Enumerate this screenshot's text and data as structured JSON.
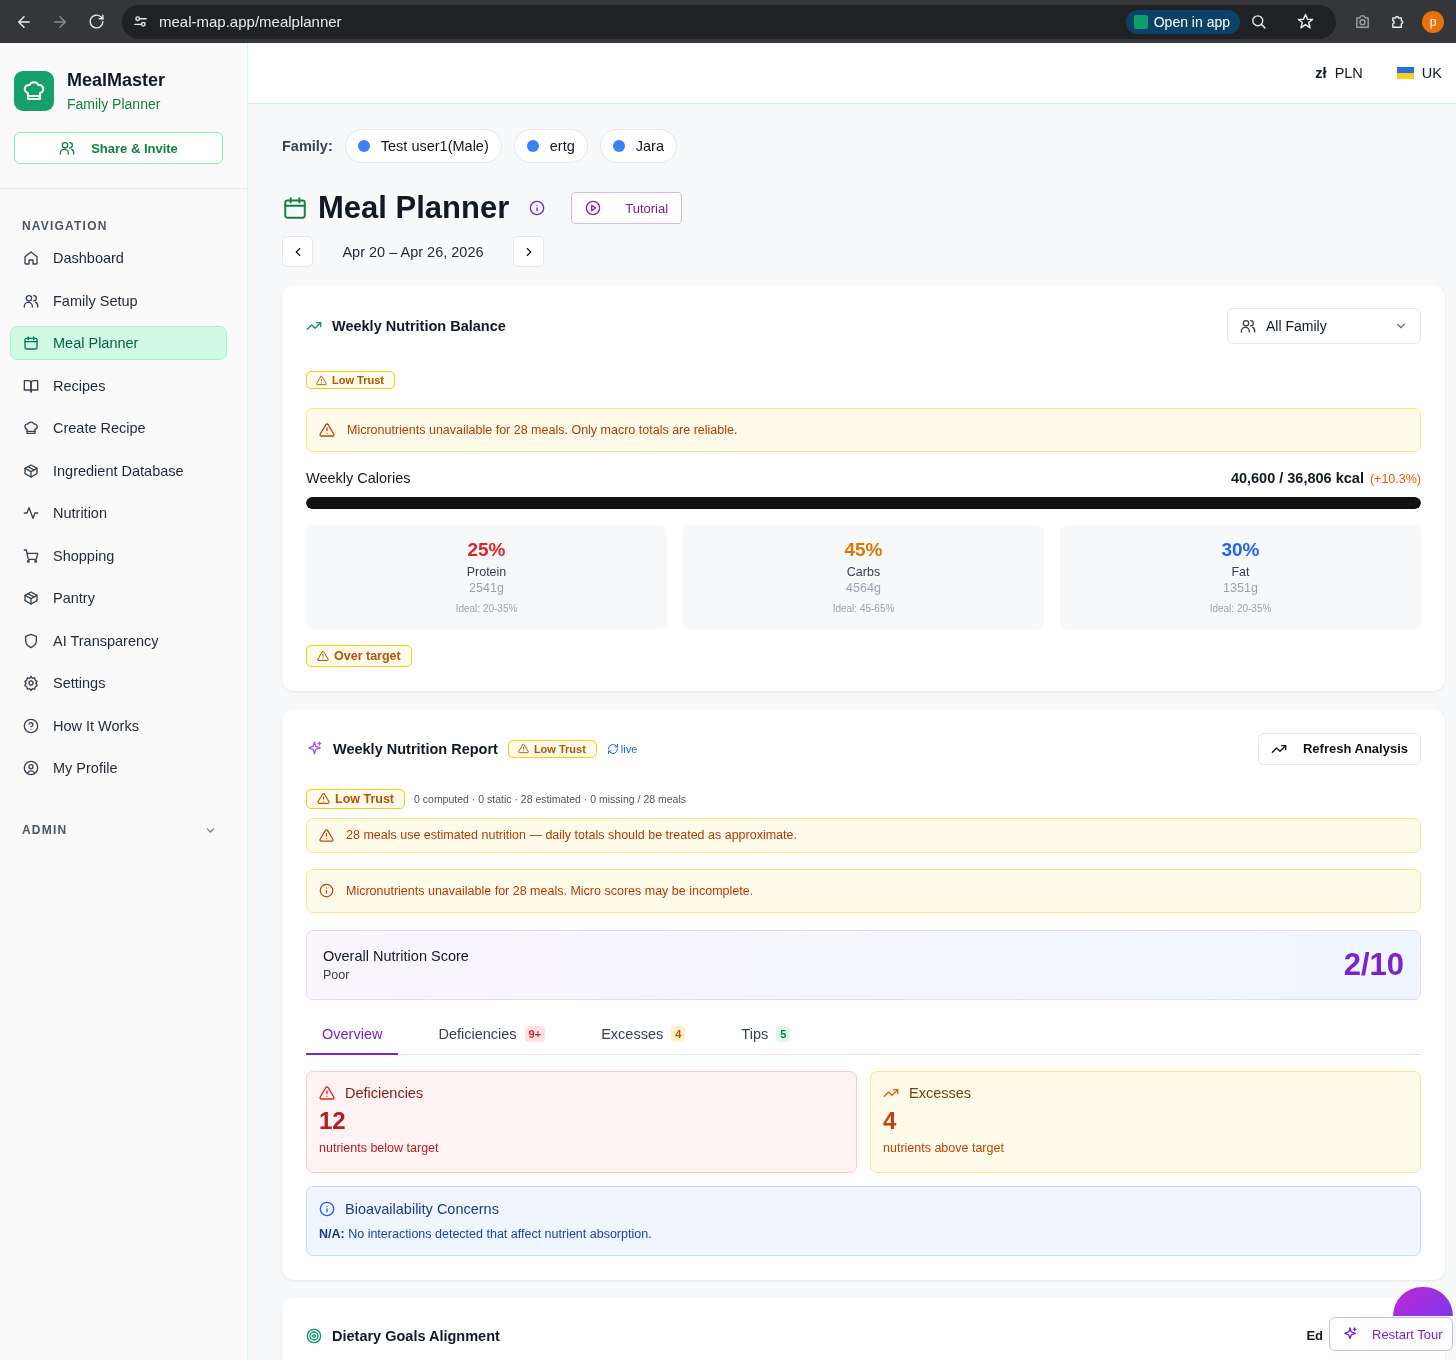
{
  "browser": {
    "url": "meal-map.app/mealplanner",
    "open_in_app": "Open in app",
    "profile_initial": "p"
  },
  "sidebar": {
    "app_name": "MealMaster",
    "subtitle": "Family Planner",
    "share_button": "Share & Invite",
    "nav_heading": "NAVIGATION",
    "items": [
      {
        "label": "Dashboard",
        "selected": false
      },
      {
        "label": "Family Setup",
        "selected": false
      },
      {
        "label": "Meal Planner",
        "selected": true
      },
      {
        "label": "Recipes",
        "selected": false
      },
      {
        "label": "Create Recipe",
        "selected": false
      },
      {
        "label": "Ingredient Database",
        "selected": false
      },
      {
        "label": "Nutrition",
        "selected": false
      },
      {
        "label": "Shopping",
        "selected": false
      },
      {
        "label": "Pantry",
        "selected": false
      },
      {
        "label": "AI Transparency",
        "selected": false
      },
      {
        "label": "Settings",
        "selected": false
      },
      {
        "label": "How It Works",
        "selected": false
      },
      {
        "label": "My Profile",
        "selected": false
      }
    ],
    "admin_heading": "ADMIN",
    "admin_expanded": false
  },
  "topbar": {
    "currency_symbol": "zł",
    "currency": "PLN",
    "language": "UK"
  },
  "family": {
    "label": "Family:",
    "members": [
      {
        "name": "Test user1(Male)",
        "color": "#3b82f6"
      },
      {
        "name": "ertg",
        "color": "#3b82f6"
      },
      {
        "name": "Jara",
        "color": "#3b82f6"
      }
    ]
  },
  "header": {
    "title": "Meal Planner",
    "tutorial": "Tutorial",
    "date_range": "Apr 20 – Apr 26, 2026"
  },
  "balance": {
    "title": "Weekly Nutrition Balance",
    "filter": "All Family",
    "trust_badge": "Low Trust",
    "warning": "Micronutrients unavailable for 28 meals. Only macro totals are reliable.",
    "calories_label": "Weekly Calories",
    "calories_value": "40,600 / 36,806 kcal",
    "calories_delta": "(+10.3%)",
    "level": 1,
    "macros": [
      {
        "percent": "25%",
        "name": "Protein",
        "grams": "2541g",
        "ideal": "Ideal: 20-35%",
        "color": "#dc2626"
      },
      {
        "percent": "45%",
        "name": "Carbs",
        "grams": "4564g",
        "ideal": "Ideal: 45-65%",
        "color": "#d97706"
      },
      {
        "percent": "30%",
        "name": "Fat",
        "grams": "1351g",
        "ideal": "Ideal: 20-35%",
        "color": "#2563eb"
      }
    ],
    "status_badge": "Over target"
  },
  "report": {
    "title": "Weekly Nutrition Report",
    "trust_badge": "Low Trust",
    "live": "live",
    "refresh": "Refresh Analysis",
    "trust_badge_large": "Low Trust",
    "counts": "0 computed · 0 static · 28 estimated · 0 missing / 28 meals",
    "alerts": [
      {
        "kind": "warning",
        "text": "28 meals use estimated nutrition — daily totals should be treated as approximate."
      },
      {
        "kind": "info",
        "text": "Micronutrients unavailable for 28 meals. Micro scores may be incomplete."
      }
    ],
    "score": {
      "label": "Overall Nutrition Score",
      "rating": "Poor",
      "value": "2/10"
    },
    "tabs": [
      {
        "label": "Overview",
        "selected": true
      },
      {
        "label": "Deficiencies",
        "selected": false,
        "count": "9+",
        "kind": "danger"
      },
      {
        "label": "Excesses",
        "selected": false,
        "count": "4",
        "kind": "warning"
      },
      {
        "label": "Tips",
        "selected": false,
        "count": "5",
        "kind": "success"
      }
    ],
    "summary": [
      {
        "kind": "deficiency",
        "title": "Deficiencies",
        "count": "12",
        "caption": "nutrients below target"
      },
      {
        "kind": "excess",
        "title": "Excesses",
        "count": "4",
        "caption": "nutrients above target"
      }
    ],
    "bioavailability": {
      "title": "Bioavailability Concerns",
      "text": "**N/A:** No interactions detected that affect nutrient absorption."
    }
  },
  "goals": {
    "title": "Dietary Goals Alignment",
    "action": "Ed"
  },
  "restart_tour": "Restart Tour"
}
